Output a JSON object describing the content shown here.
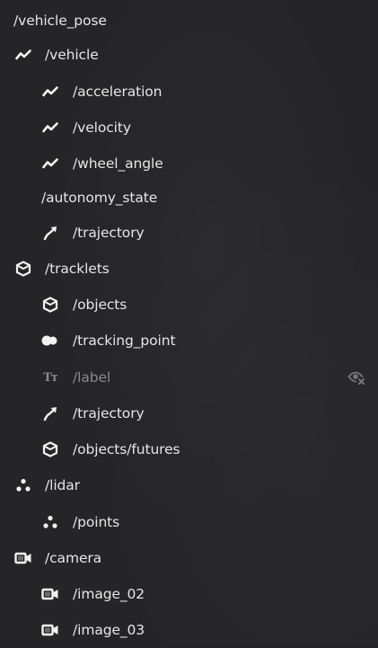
{
  "tree": {
    "items": [
      {
        "label": "/vehicle_pose",
        "icon": "none"
      },
      {
        "label": "/vehicle",
        "icon": "line-chart-icon"
      },
      {
        "label": "/acceleration",
        "icon": "line-chart-icon"
      },
      {
        "label": "/velocity",
        "icon": "line-chart-icon"
      },
      {
        "label": "/wheel_angle",
        "icon": "line-chart-icon"
      },
      {
        "label": "/autonomy_state",
        "icon": "none"
      },
      {
        "label": "/trajectory",
        "icon": "trajectory-arrow-icon"
      },
      {
        "label": "/tracklets",
        "icon": "cube-icon"
      },
      {
        "label": "/objects",
        "icon": "cube-icon"
      },
      {
        "label": "/tracking_point",
        "icon": "tracking-point-icon"
      },
      {
        "label": "/label",
        "icon": "text-icon",
        "hidden": true
      },
      {
        "label": "/trajectory",
        "icon": "trajectory-arrow-icon"
      },
      {
        "label": "/objects/futures",
        "icon": "cube-icon"
      },
      {
        "label": "/lidar",
        "icon": "point-cloud-icon"
      },
      {
        "label": "/points",
        "icon": "point-cloud-icon"
      },
      {
        "label": "/camera",
        "icon": "camera-icon"
      },
      {
        "label": "/image_02",
        "icon": "camera-icon"
      },
      {
        "label": "/image_03",
        "icon": "camera-icon"
      }
    ],
    "text_icon_glyph": "Tт"
  },
  "colors": {
    "background": "#252527",
    "text": "#e6e6e6",
    "dimmed_text": "#8a8a8c"
  }
}
